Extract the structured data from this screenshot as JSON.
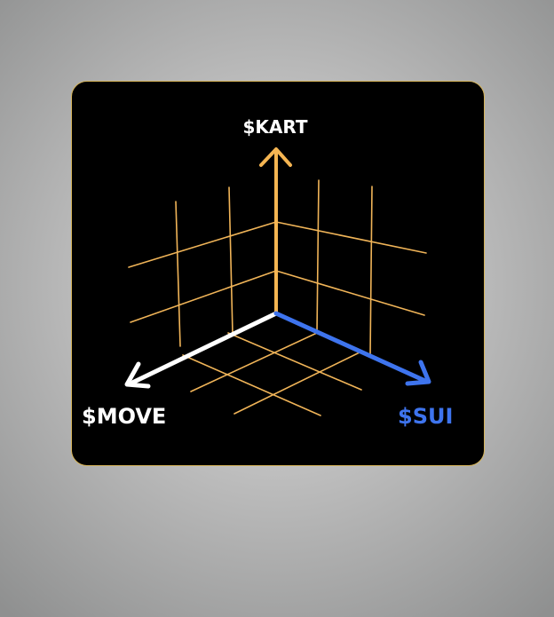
{
  "diagram": {
    "axes": {
      "vertical": {
        "label": "$KART",
        "color": "#f5b552"
      },
      "left": {
        "label": "$MOVE",
        "color": "#ffffff"
      },
      "right": {
        "label": "$SUI",
        "color": "#3e74ee"
      }
    },
    "grid_color": "#f0b458",
    "background": "#000000",
    "border_color": "#d6b45a"
  }
}
